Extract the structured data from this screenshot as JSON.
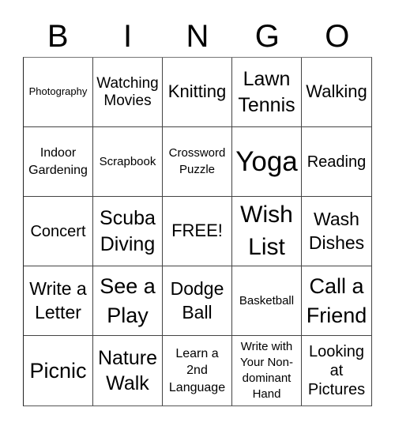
{
  "header": {
    "letters": [
      "B",
      "I",
      "N",
      "G",
      "O"
    ]
  },
  "cells": [
    "Photography",
    "Watching Movies",
    "Knitting",
    "Lawn Tennis",
    "Walking",
    "Indoor Gardening",
    "Scrapbook",
    "Crossword Puzzle",
    "Yoga",
    "Reading",
    "Concert",
    "Scuba Diving",
    "FREE!",
    "Wish List",
    "Wash Dishes",
    "Write a Letter",
    "See a Play",
    "Dodge Ball",
    "Basketball",
    "Call a Friend",
    "Picnic",
    "Nature Walk",
    "Learn a 2nd Language",
    "Write with Your Non-dominant Hand",
    "Looking at Pictures"
  ]
}
